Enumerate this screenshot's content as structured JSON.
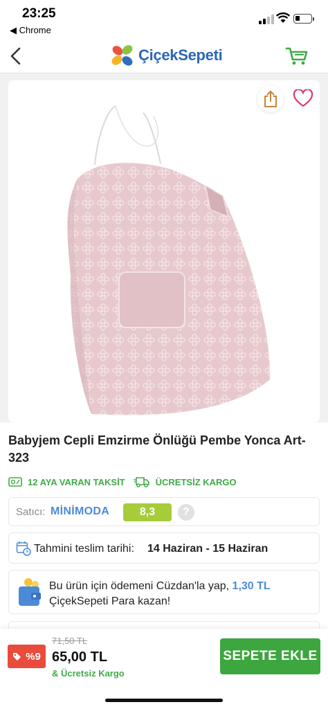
{
  "status_bar": {
    "time": "23:25",
    "back_app": "◀ Chrome",
    "battery_level": 0.3
  },
  "header": {
    "logo_text": "ÇiçekSepeti"
  },
  "product": {
    "title": "Babyjem Cepli Emzirme Önlüğü Pembe Yonca Art-323",
    "installment_badge": "12 AYA VARAN TAKSİT",
    "shipping_badge": "ÜCRETSİZ KARGO"
  },
  "seller": {
    "label": "Satıcı:",
    "name": "MİNİMODA",
    "score": "8,3",
    "help": "?"
  },
  "delivery": {
    "label": "Tahmini teslim tarihi:",
    "dates": "14 Haziran - 15 Haziran"
  },
  "wallet": {
    "text_before": "Bu ürün için ödemeni Cüzdan'la yap, ",
    "amount": "1,30 TL",
    "text_after": "ÇiçekSepeti Para kazan!"
  },
  "bottom_bar": {
    "discount": "%9",
    "old_price": "71,50 TL",
    "price": "65,00 TL",
    "free_shipping": "& Ücretsiz Kargo",
    "add_to_cart": "SEPETE EKLE"
  },
  "colors": {
    "brand_blue": "#2b67b6",
    "green": "#3faa47",
    "cart_button": "#3da63f",
    "score_bg": "#a6cc3a",
    "discount_red": "#e94b3c",
    "favorite_pink": "#e0356a"
  },
  "icons": {
    "nav_back": "chevron-left-icon",
    "cart": "cart-icon",
    "share": "share-icon",
    "favorite": "heart-icon",
    "installment": "credit-card-icon",
    "truck": "truck-icon",
    "calendar": "calendar-icon",
    "wallet": "wallet-icon",
    "tag": "tag-icon"
  }
}
